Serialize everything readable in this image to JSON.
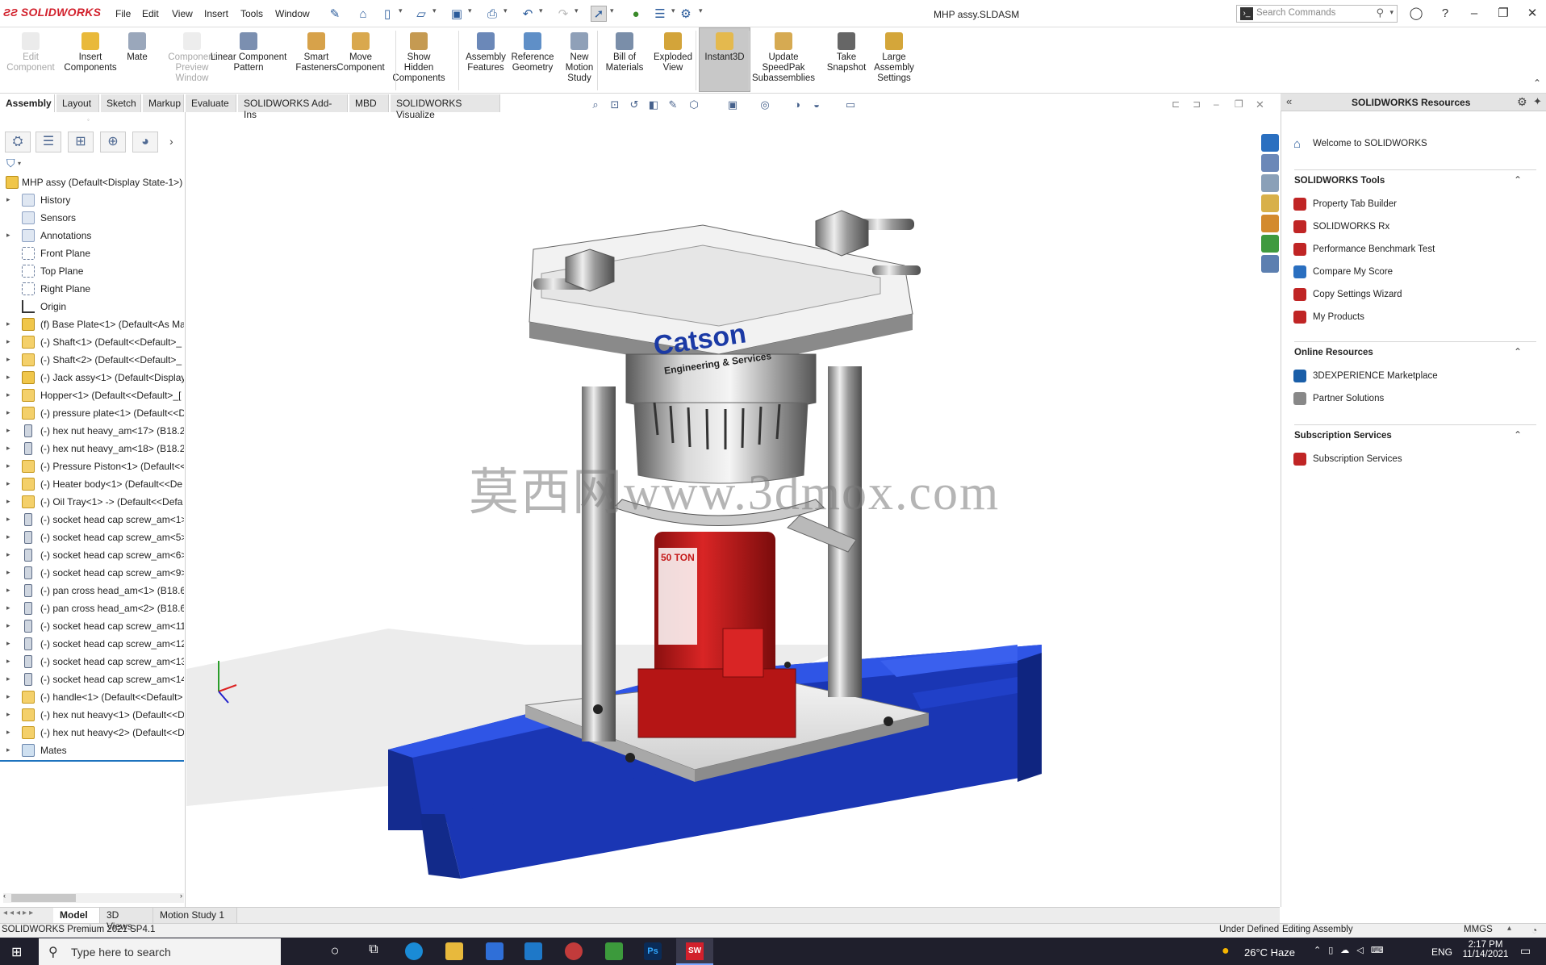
{
  "app": {
    "brand": "SOLIDWORKS",
    "document_title": "MHP assy.SLDASM"
  },
  "menu": [
    "File",
    "Edit",
    "View",
    "Insert",
    "Tools",
    "Window"
  ],
  "search": {
    "placeholder": "Search Commands"
  },
  "ribbon": [
    {
      "label": "Edit\nComponent",
      "icon": "edit-component-icon",
      "disabled": true
    },
    {
      "label": "Insert\nComponents",
      "icon": "insert-components-icon"
    },
    {
      "label": "Mate",
      "icon": "mate-icon"
    },
    {
      "label": "Component\nPreview\nWindow",
      "icon": "preview-window-icon",
      "disabled": true
    },
    {
      "label": "Linear Component\nPattern",
      "icon": "linear-pattern-icon"
    },
    {
      "label": "Smart\nFasteners",
      "icon": "smart-fasteners-icon"
    },
    {
      "label": "Move\nComponent",
      "icon": "move-component-icon"
    },
    {
      "label": "Show\nHidden\nComponents",
      "icon": "show-hidden-icon"
    },
    {
      "label": "Assembly\nFeatures",
      "icon": "assembly-features-icon"
    },
    {
      "label": "Reference\nGeometry",
      "icon": "reference-geometry-icon"
    },
    {
      "label": "New\nMotion\nStudy",
      "icon": "motion-study-icon"
    },
    {
      "label": "Bill of\nMaterials",
      "icon": "bom-icon"
    },
    {
      "label": "Exploded\nView",
      "icon": "exploded-view-icon"
    },
    {
      "label": "Instant3D",
      "icon": "instant3d-icon",
      "active": true
    },
    {
      "label": "Update\nSpeedPak\nSubassemblies",
      "icon": "speedpak-icon"
    },
    {
      "label": "Take\nSnapshot",
      "icon": "snapshot-icon"
    },
    {
      "label": "Large\nAssembly\nSettings",
      "icon": "large-assembly-icon"
    }
  ],
  "command_tabs": [
    "Assembly",
    "Layout",
    "Sketch",
    "Markup",
    "Evaluate",
    "SOLIDWORKS Add-Ins",
    "MBD",
    "SOLIDWORKS Visualize"
  ],
  "tree": {
    "root": "MHP assy  (Default<Display State-1>)",
    "items": [
      {
        "label": "History",
        "type": "fld",
        "expand": true
      },
      {
        "label": "Sensors",
        "type": "fld"
      },
      {
        "label": "Annotations",
        "type": "fld",
        "expand": true
      },
      {
        "label": "Front Plane",
        "type": "pln"
      },
      {
        "label": "Top Plane",
        "type": "pln"
      },
      {
        "label": "Right Plane",
        "type": "pln"
      },
      {
        "label": "Origin",
        "type": "org"
      },
      {
        "label": "(f) Base Plate<1> (Default<As Ma",
        "type": "asm",
        "expand": true
      },
      {
        "label": "(-) Shaft<1> (Default<<Default>_",
        "type": "prt",
        "expand": true
      },
      {
        "label": "(-) Shaft<2> (Default<<Default>_",
        "type": "prt",
        "expand": true
      },
      {
        "label": "(-) Jack assy<1> (Default<Display",
        "type": "asm",
        "expand": true
      },
      {
        "label": "Hopper<1> (Default<<Default>_[",
        "type": "prt",
        "expand": true
      },
      {
        "label": "(-) pressure plate<1> (Default<<D",
        "type": "prt",
        "expand": true
      },
      {
        "label": "(-) hex nut heavy_am<17> (B18.2.",
        "type": "scr",
        "expand": true
      },
      {
        "label": "(-) hex nut heavy_am<18> (B18.2.",
        "type": "scr",
        "expand": true
      },
      {
        "label": "(-) Pressure Piston<1> (Default<<",
        "type": "prt",
        "expand": true
      },
      {
        "label": "(-) Heater body<1> (Default<<De",
        "type": "prt",
        "expand": true
      },
      {
        "label": "(-) Oil Tray<1> -> (Default<<Defa",
        "type": "prt",
        "expand": true
      },
      {
        "label": "(-) socket head cap screw_am<1>",
        "type": "scr",
        "expand": true
      },
      {
        "label": "(-) socket head cap screw_am<5>",
        "type": "scr",
        "expand": true
      },
      {
        "label": "(-) socket head cap screw_am<6>",
        "type": "scr",
        "expand": true
      },
      {
        "label": "(-) socket head cap screw_am<9>",
        "type": "scr",
        "expand": true
      },
      {
        "label": "(-) pan cross head_am<1> (B18.6.",
        "type": "scr",
        "expand": true
      },
      {
        "label": "(-) pan cross head_am<2> (B18.6.",
        "type": "scr",
        "expand": true
      },
      {
        "label": "(-) socket head cap screw_am<11",
        "type": "scr",
        "expand": true
      },
      {
        "label": "(-) socket head cap screw_am<12",
        "type": "scr",
        "expand": true
      },
      {
        "label": "(-) socket head cap screw_am<13",
        "type": "scr",
        "expand": true
      },
      {
        "label": "(-) socket head cap screw_am<14",
        "type": "scr",
        "expand": true
      },
      {
        "label": "(-) handle<1> (Default<<Default>",
        "type": "prt",
        "expand": true
      },
      {
        "label": "(-) hex nut heavy<1> (Default<<D",
        "type": "prt",
        "expand": true
      },
      {
        "label": "(-) hex nut heavy<2> (Default<<D",
        "type": "prt",
        "expand": true
      },
      {
        "label": "Mates",
        "type": "mat",
        "expand": true
      }
    ]
  },
  "viewport": {
    "watermark": "莫西网www.3dmox.com",
    "logo_line1": "Catson",
    "logo_line2": "Engineering & Services",
    "jack_label": "50 TON"
  },
  "taskpane": {
    "title": "SOLIDWORKS Resources",
    "welcome": "Welcome to SOLIDWORKS",
    "sections": [
      {
        "title": "SOLIDWORKS Tools",
        "items": [
          "Property Tab Builder",
          "SOLIDWORKS Rx",
          "Performance Benchmark Test",
          "Compare My Score",
          "Copy Settings Wizard",
          "My Products"
        ]
      },
      {
        "title": "Online Resources",
        "items": [
          "3DEXPERIENCE Marketplace",
          "Partner Solutions"
        ]
      },
      {
        "title": "Subscription Services",
        "items": [
          "Subscription Services"
        ]
      }
    ]
  },
  "bottom_tabs": [
    "Model",
    "3D Views",
    "Motion Study 1"
  ],
  "status": {
    "product": "SOLIDWORKS Premium 2021 SP4.1",
    "state": "Under Defined",
    "mode": "Editing Assembly",
    "units": "MMGS"
  },
  "taskbar": {
    "search": "Type here to search",
    "weather": "26°C  Haze",
    "lang": "ENG",
    "time": "2:17 PM",
    "date": "11/14/2021"
  },
  "colors": {
    "brand": "#d2202c",
    "frame_blue": "#1f3fc4",
    "jack_red": "#c51a1a",
    "taskbar": "#1f1f2c"
  }
}
